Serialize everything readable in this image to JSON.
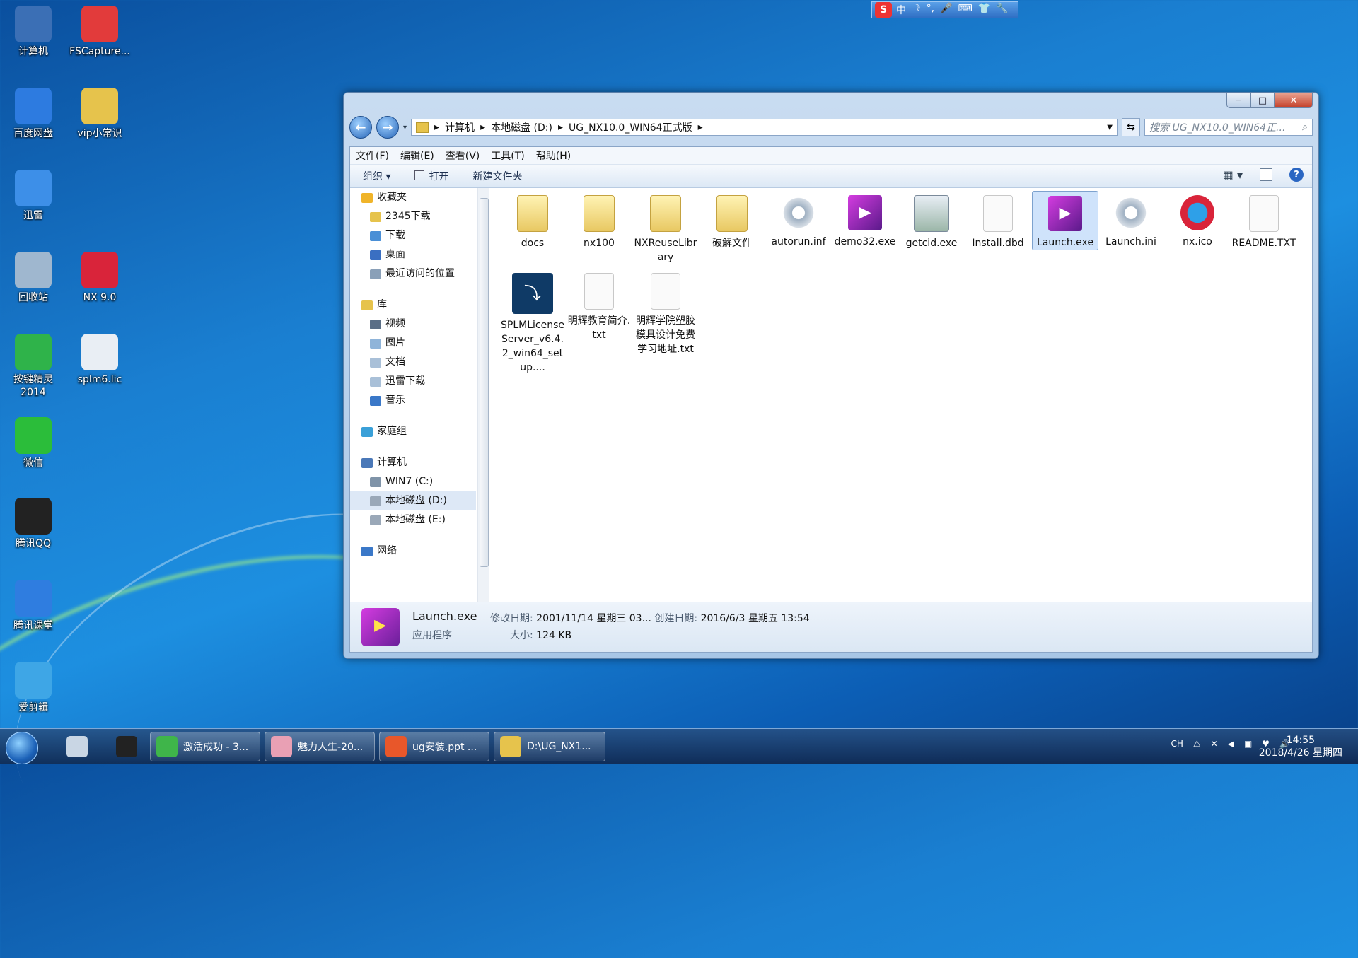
{
  "desktop": {
    "icons": [
      {
        "label": "计算机",
        "icon": "computer-icon",
        "color": "#3b6fb5"
      },
      {
        "label": "FSCapture...",
        "icon": "fscapture-icon",
        "color": "#e23b3b"
      },
      {
        "label": "百度网盘",
        "icon": "baidu-netdisk-icon",
        "color": "#2d7be0"
      },
      {
        "label": "vip小常识",
        "icon": "zip-folder-icon",
        "color": "#e6c34c"
      },
      {
        "label": "迅雷",
        "icon": "xunlei-icon",
        "color": "#3d8fe8"
      },
      {
        "label": "回收站",
        "icon": "recycle-bin-icon",
        "color": "#9fb7cf"
      },
      {
        "label": "NX 9.0",
        "icon": "nx-icon",
        "color": "#d9243a"
      },
      {
        "label": "按键精灵\n2014",
        "icon": "anjian-icon",
        "color": "#2fb34a"
      },
      {
        "label": "splm6.lic",
        "icon": "lic-file-icon",
        "color": "#e9eef4"
      },
      {
        "label": "微信",
        "icon": "wechat-icon",
        "color": "#2bbd3a"
      },
      {
        "label": "腾讯QQ",
        "icon": "qq-icon",
        "color": "#222222"
      },
      {
        "label": "腾讯课堂",
        "icon": "tencent-classroom-icon",
        "color": "#2f7de0"
      },
      {
        "label": "爱剪辑",
        "icon": "aijianji-icon",
        "color": "#3ea6e6"
      }
    ]
  },
  "ime": {
    "logo": "S",
    "items": [
      "中",
      "☽",
      "°,",
      "🎤",
      "⌨",
      "👕",
      "🔧"
    ]
  },
  "window": {
    "controls": {
      "minimize": "─",
      "maximize": "□",
      "close": "✕"
    },
    "address": {
      "crumbs": [
        "计算机",
        "本地磁盘 (D:)",
        "UG_NX10.0_WIN64正式版"
      ]
    },
    "search_placeholder": "搜索 UG_NX10.0_WIN64正...",
    "menu": [
      "文件(F)",
      "编辑(E)",
      "查看(V)",
      "工具(T)",
      "帮助(H)"
    ],
    "toolbar": {
      "organize": "组织 ▾",
      "open": "打开",
      "new_folder": "新建文件夹"
    },
    "nav": [
      {
        "label": "收藏夹",
        "indent": 0,
        "icon": "star-icon",
        "color": "#f0b429"
      },
      {
        "label": "2345下载",
        "indent": 1,
        "icon": "folder-icon",
        "color": "#e6c34c"
      },
      {
        "label": "下载",
        "indent": 1,
        "icon": "download-folder-icon",
        "color": "#4a8fd6"
      },
      {
        "label": "桌面",
        "indent": 1,
        "icon": "desktop-icon",
        "color": "#3a6fc2"
      },
      {
        "label": "最近访问的位置",
        "indent": 1,
        "icon": "recent-places-icon",
        "color": "#8aa0b8"
      },
      {
        "label": "",
        "indent": 0,
        "icon": "",
        "color": ""
      },
      {
        "label": "库",
        "indent": 0,
        "icon": "library-icon",
        "color": "#e6c34c"
      },
      {
        "label": "视频",
        "indent": 1,
        "icon": "video-icon",
        "color": "#5a6e86"
      },
      {
        "label": "图片",
        "indent": 1,
        "icon": "pictures-icon",
        "color": "#8fb4d9"
      },
      {
        "label": "文档",
        "indent": 1,
        "icon": "documents-icon",
        "color": "#a9c0d8"
      },
      {
        "label": "迅雷下载",
        "indent": 1,
        "icon": "xunlei-download-icon",
        "color": "#a9c0d8"
      },
      {
        "label": "音乐",
        "indent": 1,
        "icon": "music-icon",
        "color": "#3a78c8"
      },
      {
        "label": "",
        "indent": 0,
        "icon": "",
        "color": ""
      },
      {
        "label": "家庭组",
        "indent": 0,
        "icon": "homegroup-icon",
        "color": "#3aa0d8"
      },
      {
        "label": "",
        "indent": 0,
        "icon": "",
        "color": ""
      },
      {
        "label": "计算机",
        "indent": 0,
        "icon": "computer-icon",
        "color": "#4a78b8"
      },
      {
        "label": "WIN7 (C:)",
        "indent": 1,
        "icon": "drive-icon",
        "color": "#7f93a8"
      },
      {
        "label": "本地磁盘 (D:)",
        "indent": 1,
        "icon": "drive-icon",
        "color": "#9aa8b8",
        "selected": true
      },
      {
        "label": "本地磁盘 (E:)",
        "indent": 1,
        "icon": "drive-icon",
        "color": "#9aa8b8"
      },
      {
        "label": "",
        "indent": 0,
        "icon": "",
        "color": ""
      },
      {
        "label": "网络",
        "indent": 0,
        "icon": "network-icon",
        "color": "#3a78c8"
      }
    ],
    "files": [
      {
        "name": "docs",
        "type": "folder",
        "icon": "folder-icon"
      },
      {
        "name": "nx100",
        "type": "folder",
        "icon": "folder-icon"
      },
      {
        "name": "NXReuseLibrary",
        "type": "folder",
        "icon": "folder-icon"
      },
      {
        "name": "破解文件",
        "type": "folder",
        "icon": "folder-icon"
      },
      {
        "name": "autorun.inf",
        "type": "gear",
        "icon": "settings-file-icon"
      },
      {
        "name": "demo32.exe",
        "type": "exe",
        "icon": "play-exe-icon"
      },
      {
        "name": "getcid.exe",
        "type": "exe2",
        "icon": "window-exe-icon"
      },
      {
        "name": "Install.dbd",
        "type": "doc",
        "icon": "blank-file-icon"
      },
      {
        "name": "Launch.exe",
        "type": "exe",
        "icon": "launch-exe-icon",
        "selected": true
      },
      {
        "name": "Launch.ini",
        "type": "gear",
        "icon": "settings-file-icon"
      },
      {
        "name": "nx.ico",
        "type": "nx",
        "icon": "nx-icon"
      },
      {
        "name": "README.TXT",
        "type": "doc",
        "icon": "text-file-icon"
      },
      {
        "name": "SPLMLicenseServer_v6.4.2_win64_setup....",
        "type": "setup",
        "icon": "setup-icon"
      },
      {
        "name": "明辉教育简介.txt",
        "type": "doc",
        "icon": "text-file-icon"
      },
      {
        "name": "明辉学院塑胶模具设计免费学习地址.txt",
        "type": "doc",
        "icon": "text-file-icon"
      }
    ],
    "details": {
      "name": "Launch.exe",
      "modified_label": "修改日期:",
      "modified": "2001/11/14 星期三 03...",
      "created_label": "创建日期:",
      "created": "2016/6/3 星期五 13:54",
      "type": "应用程序",
      "size_label": "大小:",
      "size": "124 KB"
    }
  },
  "taskbar": {
    "items": [
      {
        "label": "",
        "icon": "calculator-icon",
        "color": "#c9d6e4"
      },
      {
        "label": "",
        "icon": "qq-icon",
        "color": "#222222"
      },
      {
        "label": "激活成功 - 3...",
        "icon": "green-app-icon",
        "color": "#3fb54a"
      },
      {
        "label": "魅力人生-20...",
        "icon": "photo-icon",
        "color": "#e9a0b4"
      },
      {
        "label": "ug安装.ppt ...",
        "icon": "ppt-icon",
        "color": "#e8572a"
      },
      {
        "label": "D:\\UG_NX1...",
        "icon": "explorer-folder-icon",
        "color": "#e6c34c"
      }
    ],
    "tray": [
      "CH",
      "⚠",
      "✕",
      "◀",
      "▣",
      "♥",
      "🔊"
    ],
    "time": "14:55",
    "date": "2018/4/26 星期四"
  }
}
